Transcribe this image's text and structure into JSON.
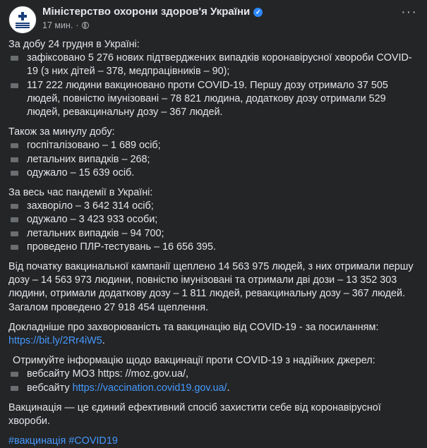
{
  "header": {
    "page_name": "Міністерство охорони здоров'я України",
    "time": "17 мин.",
    "separator": "·"
  },
  "icons": {
    "more": "more-horizontal-icon",
    "verified": "verified-badge-icon",
    "privacy": "globe-icon",
    "bullet": "square-bullet-icon",
    "accent": "#2d88ff"
  },
  "post": {
    "s1_intro": "За добу 24 грудня в Україні:",
    "s1_items": [
      "зафіксовано 5 276 нових підтверджених випадків коронавірусної хвороби COVID-19 (з них дітей – 378, медпрацівників – 90);",
      "117 222 людини вакциновано проти COVID-19. Першу дозу отримало 37 505 людей, повністю імунізовані – 78 821 людина, додаткову дозу отримали 529 людей, ревакцинальну дозу – 367 людей."
    ],
    "s2_intro": "Також за минулу добу:",
    "s2_items": [
      "госпіталізовано – 1 689 осіб;",
      "летальних випадків – 268;",
      "одужало – 15 639 осіб."
    ],
    "s3_intro": "За весь час пандемії в Україні:",
    "s3_items": [
      "захворіло – 3 642 314 осіб;",
      "одужало – 3 423 933 особи;",
      "летальних випадків – 94 700;",
      "проведено ПЛР-тестувань – 16 656 395."
    ],
    "campaign_text": "Від початку вакцинальної кампанії щеплено 14 563 975 людей, з них отримали першу дозу – 14 563 973 людини, повністю імунізовані та отримали дві дози – 13 352 303 людини, отримали додаткову дозу – 1 811 людей, ревакцинальну дозу – 367 людей. Загалом проведено 27 918 454 щеплення.",
    "more_info_text": "Докладніше про захворюваність та вакцинацію від COVID-19 - за посиланням:",
    "more_info_link": "https://bit.ly/2Rr4iW5",
    "more_info_end": ".",
    "sources_intro": "Отримуйте інформацію щодо вакцинації проти COVID-19 з надійних джерел:",
    "source1": "вебсайту МОЗ https: //moz.gov.ua/,",
    "source2_prefix": "вебсайту",
    "source2_link": "https://vaccination.covid19.gov.ua/",
    "source2_end": ".",
    "closing": "Вакцинація — це єдиний ефективний спосіб захистити себе від коронавірусної хвороби.",
    "hashtags": "#вакцинація #COVID19"
  }
}
